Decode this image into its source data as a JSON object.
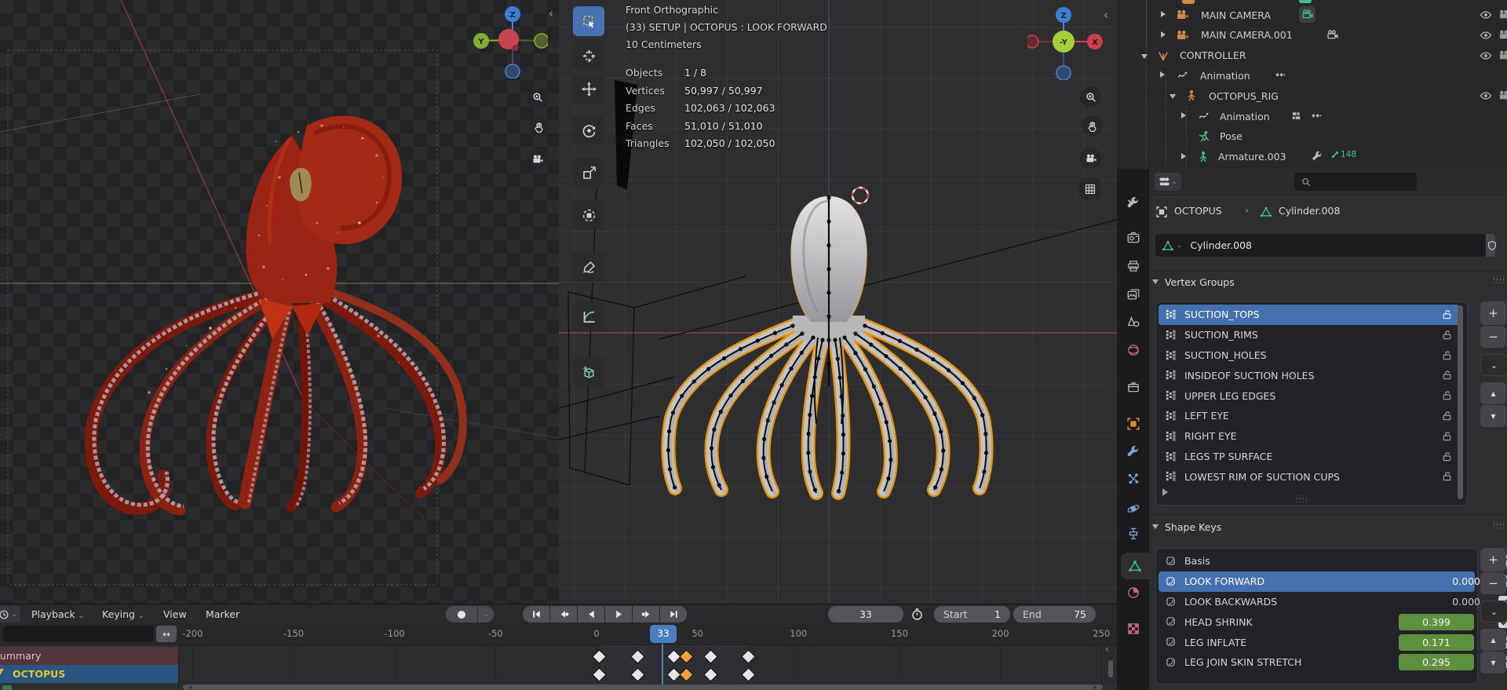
{
  "left_viewport": {
    "collapse_icon": "‹",
    "nav_buttons": [
      "zoom-icon",
      "hand-icon",
      "camera-icon"
    ],
    "gizmo": {
      "up": "Z",
      "left": "Y"
    }
  },
  "main_viewport": {
    "collapse_icon": "‹",
    "header": [
      "Front Orthographic",
      "(33) SETUP | OCTOPUS : LOOK FORWARD",
      "10 Centimeters"
    ],
    "stats": [
      {
        "label": "Objects",
        "value": "1 / 8"
      },
      {
        "label": "Vertices",
        "value": "50,997 / 50,997"
      },
      {
        "label": "Edges",
        "value": "102,063 / 102,063"
      },
      {
        "label": "Faces",
        "value": "51,010 / 51,010"
      },
      {
        "label": "Triangles",
        "value": "102,050 / 102,050"
      }
    ],
    "toolbar": [
      {
        "name": "select-box-tool",
        "active": true
      },
      {
        "name": "cursor-tool",
        "active": false
      },
      {
        "name": "move-tool",
        "active": false
      },
      {
        "name": "rotate-tool",
        "active": false
      },
      {
        "name": "scale-tool",
        "active": false
      },
      {
        "name": "transform-tool",
        "active": false
      },
      {
        "name": "annotate-tool",
        "active": false
      },
      {
        "name": "measure-tool",
        "active": false
      },
      {
        "name": "add-cube-tool",
        "active": false
      }
    ],
    "nav_buttons": [
      "zoom-icon",
      "hand-icon",
      "camera-icon",
      "grid-icon"
    ],
    "gizmo": {
      "up": "Z",
      "center": "-Y",
      "right": "X"
    }
  },
  "outliner": {
    "rows": [
      {
        "label": "MAIN CAMERA",
        "icon": "camera-icon",
        "icon_color": "#cf8a45",
        "arrow": "right",
        "badges": [
          "active-camera-badge"
        ],
        "eye": true
      },
      {
        "label": "MAIN CAMERA.001",
        "icon": "camera-icon",
        "icon_color": "#cf8a45",
        "arrow": "right",
        "badges": [
          "camera-data-icon"
        ],
        "eye": true
      },
      {
        "label": "CONTROLLER",
        "icon": "empty-axes-icon",
        "icon_color": "#cf8a45",
        "arrow": "down",
        "badges": [],
        "eye": true
      },
      {
        "label": "Animation",
        "icon": "animation-icon",
        "icon_color": "#c9c9cc",
        "arrow": "right",
        "badges": [
          "keyframes-icon"
        ],
        "eye": false
      },
      {
        "label": "OCTOPUS_RIG",
        "icon": "armature-icon",
        "icon_color": "#cf8a45",
        "arrow": "down",
        "badges": [],
        "eye": true
      },
      {
        "label": "Animation",
        "icon": "animation-icon",
        "icon_color": "#c9c9cc",
        "arrow": "right",
        "badges": [
          "nla-icon",
          "keyframes-icon"
        ],
        "eye": false
      },
      {
        "label": "Pose",
        "icon": "pose-icon",
        "icon_color": "#52c878",
        "arrow": null,
        "badges": [],
        "eye": false
      },
      {
        "label": "Armature.003",
        "icon": "armature-icon",
        "icon_color": "#3fc08d",
        "arrow": "right",
        "badges": [
          "wrench-icon",
          "bone-count-badge"
        ],
        "eye": false,
        "badge_count": "148"
      }
    ]
  },
  "properties": {
    "search_placeholder": "",
    "breadcrumb": {
      "object": "OCTOPUS",
      "separator": "›",
      "data": "Cylinder.008"
    },
    "name_field": {
      "value": "Cylinder.008"
    },
    "tabs": [
      {
        "name": "tool",
        "color": "#b8b8bc"
      },
      {
        "name": "render",
        "color": "#b8b8bc"
      },
      {
        "name": "output",
        "color": "#b8b8bc"
      },
      {
        "name": "view-layer",
        "color": "#b8b8bc"
      },
      {
        "name": "scene",
        "color": "#b8b8bc"
      },
      {
        "name": "world",
        "color": "#c56a75"
      },
      {
        "name": "collection",
        "color": "#b8b8bc"
      },
      {
        "name": "object",
        "color": "#d98c3c"
      },
      {
        "name": "modifiers",
        "color": "#7aa4d8"
      },
      {
        "name": "particles",
        "color": "#7aa4d8"
      },
      {
        "name": "physics",
        "color": "#7aa4d8"
      },
      {
        "name": "constraints",
        "color": "#7aa4d8"
      },
      {
        "name": "object-data",
        "color": "#3fc08d",
        "active": true
      },
      {
        "name": "material",
        "color": "#c56a75"
      },
      {
        "name": "texture",
        "color": "#c56a75"
      }
    ],
    "vertex_groups": {
      "title": "Vertex Groups",
      "items": [
        "SUCTION_TOPS",
        "SUCTION_RIMS",
        "SUCTION_HOLES",
        "INSIDEOF SUCTION HOLES",
        "UPPER LEG EDGES",
        "LEFT EYE",
        "RIGHT EYE",
        "LEGS TP SURFACE",
        "LOWEST RIM OF SUCTION CUPS"
      ],
      "selected": "SUCTION_TOPS"
    },
    "shape_keys": {
      "title": "Shape Keys",
      "items": [
        {
          "name": "Basis",
          "value": "",
          "checked": true,
          "selected": false,
          "slider": false
        },
        {
          "name": "LOOK FORWARD",
          "value": "0.000",
          "checked": true,
          "selected": true,
          "slider": false
        },
        {
          "name": "LOOK BACKWARDS",
          "value": "0.000",
          "checked": true,
          "selected": false,
          "slider": false
        },
        {
          "name": "HEAD SHRINK",
          "value": "0.399",
          "checked": true,
          "selected": false,
          "slider": true
        },
        {
          "name": "LEG INFLATE",
          "value": "0.171",
          "checked": true,
          "selected": false,
          "slider": true
        },
        {
          "name": "LEG JOIN SKIN STRETCH",
          "value": "0.295",
          "checked": true,
          "selected": false,
          "slider": true
        }
      ]
    }
  },
  "timeline": {
    "menus": [
      "Playback",
      "Keying",
      "View",
      "Marker"
    ],
    "transport": [
      "jump-start",
      "prev-keyframe",
      "play-reverse",
      "play",
      "next-keyframe",
      "jump-end"
    ],
    "current_frame": "33",
    "frame_start_label": "Start",
    "frame_start": "1",
    "frame_end_label": "End",
    "frame_end": "75",
    "ruler_ticks": [
      -200,
      -150,
      -100,
      -50,
      0,
      50,
      100,
      150,
      200,
      250
    ],
    "channels": [
      {
        "label": "Summary",
        "type": "summary"
      },
      {
        "label": "OCTOPUS",
        "type": "object"
      }
    ],
    "keyframes": [
      1,
      20,
      38,
      44,
      56,
      75
    ],
    "selected_keyframes": [
      44
    ]
  },
  "colors": {
    "accent_blue": "#4470ae",
    "selected_keyframe": "#f0a23a",
    "slider_green": "#5d9140",
    "octopus_outline": "#e8940f",
    "summary_channel": "#54333a",
    "object_channel": "#2a5580",
    "object_channel_text": "#e3c33c"
  }
}
